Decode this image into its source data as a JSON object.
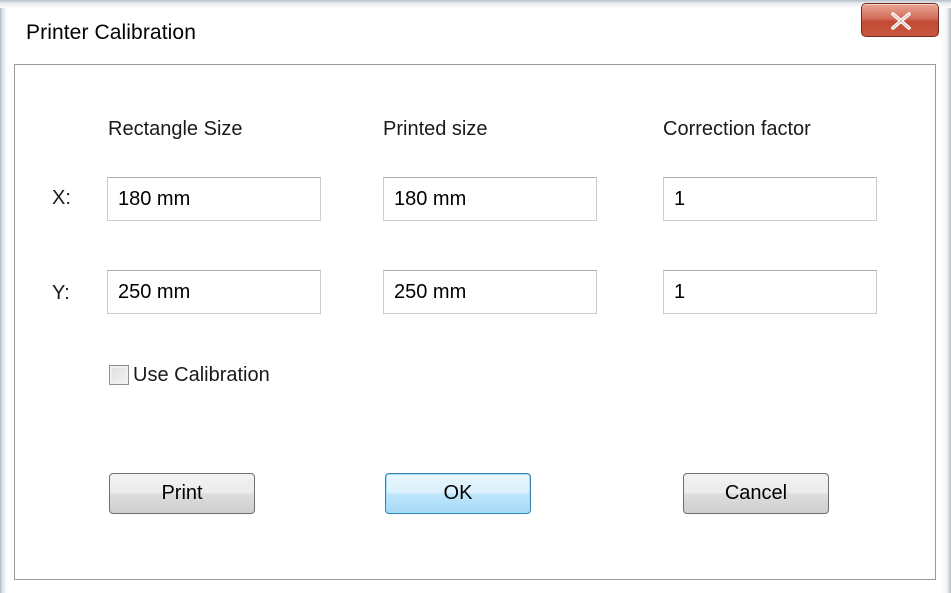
{
  "window": {
    "title": "Printer Calibration",
    "close_icon": "close-x-icon",
    "close_color": "#c9573f"
  },
  "columns": {
    "rectangle_size": "Rectangle Size",
    "printed_size": "Printed size",
    "correction_factor": "Correction factor"
  },
  "rows": {
    "x": {
      "label": "X:",
      "rectangle_size": "180 mm",
      "printed_size": "180 mm",
      "correction_factor": "1"
    },
    "y": {
      "label": "Y:",
      "rectangle_size": "250 mm",
      "printed_size": "250 mm",
      "correction_factor": "1"
    }
  },
  "use_calibration": {
    "label": "Use Calibration",
    "checked": false
  },
  "buttons": {
    "print": "Print",
    "ok": "OK",
    "cancel": "Cancel"
  },
  "colors": {
    "default_button_accent": "#3c7fb1"
  }
}
